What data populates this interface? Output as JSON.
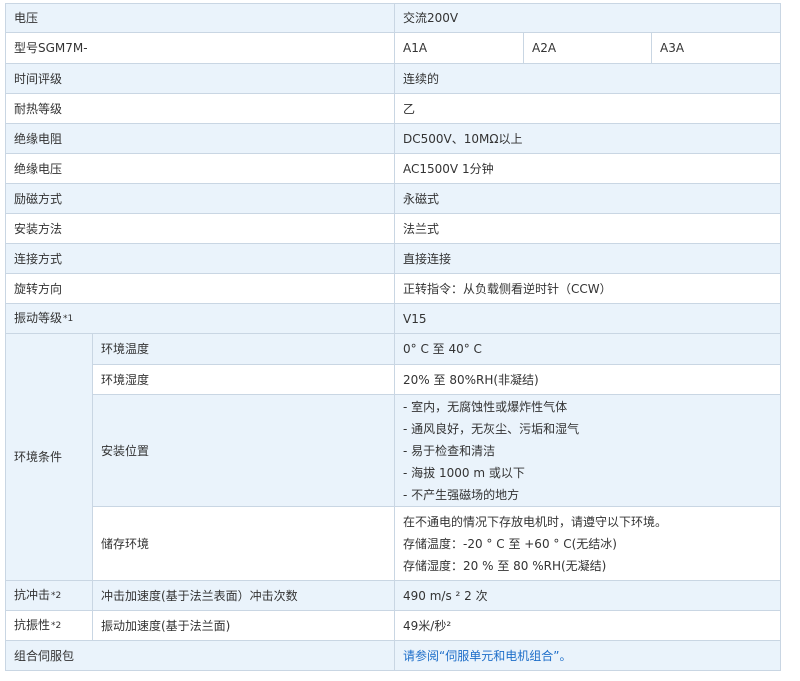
{
  "rows": {
    "voltage": {
      "label": "电压",
      "value": "交流200V"
    },
    "model": {
      "label": "型号SGM7M-",
      "options": [
        "A1A",
        "A2A",
        "A3A"
      ]
    },
    "time_rating": {
      "label": "时间评级",
      "value": "连续的"
    },
    "heat_class": {
      "label": "耐热等级",
      "value": "乙"
    },
    "insulation_resistance": {
      "label": "绝缘电阻",
      "value": "DC500V、10MΩ以上"
    },
    "insulation_voltage": {
      "label": "绝缘电压",
      "value": "AC1500V 1分钟"
    },
    "excitation": {
      "label": "励磁方式",
      "value": "永磁式"
    },
    "mounting": {
      "label": "安装方法",
      "value": "法兰式"
    },
    "connection": {
      "label": "连接方式",
      "value": "直接连接"
    },
    "rotation": {
      "label": "旋转方向",
      "value": "正转指令：从负载侧看逆时针（CCW）"
    },
    "vibration_grade": {
      "label": "振动等级",
      "note": "*1",
      "value": "V15"
    },
    "environment": {
      "label": "环境条件",
      "temperature": {
        "label": "环境温度",
        "value": "0° C 至 40° C"
      },
      "humidity": {
        "label": "环境湿度",
        "value": "20% 至 80%RH(非凝结)"
      },
      "location": {
        "label": "安装位置",
        "lines": [
          "- 室内，无腐蚀性或爆炸性气体",
          "- 通风良好，无灰尘、污垢和湿气",
          "- 易于检查和清洁",
          "- 海拔 1000 m 或以下",
          "- 不产生强磁场的地方"
        ]
      },
      "storage": {
        "label": "储存环境",
        "lines": [
          "在不通电的情况下存放电机时，请遵守以下环境。",
          "存储温度：-20 ° C 至 +60 ° C(无结冰)",
          "存储湿度：20 % 至 80 %RH(无凝结)"
        ]
      }
    },
    "shock": {
      "label": "抗冲击",
      "note": "*2",
      "sub": "冲击加速度(基于法兰表面）冲击次数",
      "value": "490 m/s ² 2 次"
    },
    "vibration": {
      "label": "抗振性",
      "note": "*2",
      "sub": "振动加速度(基于法兰面)",
      "value": "49米/秒²"
    },
    "servo_pack": {
      "label": "组合伺服包",
      "link": "请参阅“伺服单元和电机组合”。"
    }
  }
}
